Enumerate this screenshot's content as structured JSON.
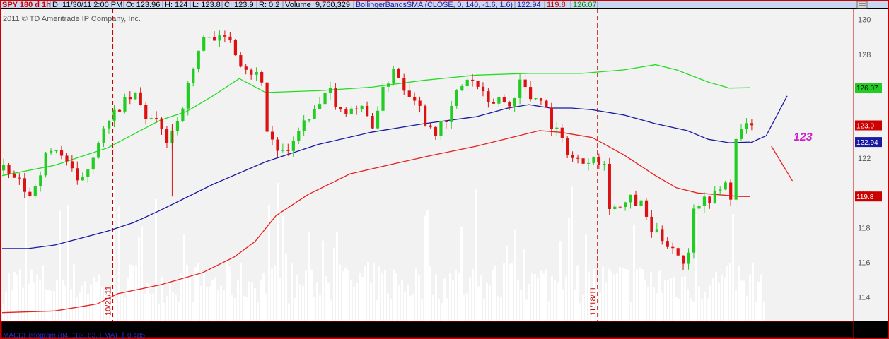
{
  "header": {
    "symbol": "SPY 180 d 1h",
    "date": "D: 11/30/11 2:00 PM",
    "open": "O: 123.96",
    "high": "H: 124",
    "low": "L: 123.8",
    "close": "C: 123.9",
    "range": "R: 0.2",
    "volume_label": "Volume",
    "volume_value": "9,760,329",
    "study_label": "BollingerBandsSMA (CLOSE, 0, 140, -1.6, 1.6)",
    "study_mid": "122.94",
    "study_low": "119.8",
    "study_up": "126.07"
  },
  "copyright": "2011 © TD Ameritrade IP Company, Inc.",
  "annotation": "123",
  "lower_panel": {
    "label": "MACDHistogram (84, 182, 63, EMA)",
    "value": "0.485"
  },
  "colors": {
    "up": "#22cc22",
    "down": "#dd1111",
    "upper_band": "#22dd22",
    "middle_band": "#1a1aa0",
    "lower_band": "#e82020",
    "annotation": "#cc22cc",
    "frame": "#cc0000",
    "plot_bg": "#f2f2f2"
  },
  "chart_data": {
    "type": "candlestick",
    "ylim": [
      112.6,
      130.6
    ],
    "y_ticks": [
      114,
      116,
      118,
      120,
      122,
      124,
      126,
      128,
      130
    ],
    "price_badges": [
      {
        "value": 126.07,
        "text": "126.07",
        "color": "#22cc22",
        "text_color": "#000"
      },
      {
        "value": 123.9,
        "text": "123.9",
        "color": "#cc0000",
        "text_color": "#fff"
      },
      {
        "value": 122.94,
        "text": "122.94",
        "color": "#1a1aa0",
        "text_color": "#fff"
      },
      {
        "value": 119.8,
        "text": "119.8",
        "color": "#cc0000",
        "text_color": "#fff"
      }
    ],
    "date_markers": [
      {
        "label": "10/21/11",
        "bar": 21
      },
      {
        "label": "11/18/11",
        "bar": 113
      }
    ],
    "close_path": [
      [
        0,
        121.3
      ],
      [
        3,
        120.6
      ],
      [
        5,
        119.8
      ],
      [
        8,
        122.1
      ],
      [
        10,
        122.6
      ],
      [
        12,
        121.8
      ],
      [
        14,
        120.5
      ],
      [
        16,
        121.5
      ],
      [
        18,
        123.1
      ],
      [
        20,
        124.0
      ],
      [
        22,
        125.0
      ],
      [
        25,
        125.6
      ],
      [
        27,
        124.4
      ],
      [
        29,
        124.0
      ],
      [
        31,
        123.1
      ],
      [
        33,
        124.2
      ],
      [
        35,
        126.1
      ],
      [
        37,
        128.2
      ],
      [
        39,
        129.3
      ],
      [
        41,
        128.8
      ],
      [
        43,
        129.0
      ],
      [
        45,
        127.6
      ],
      [
        47,
        127.0
      ],
      [
        49,
        126.6
      ],
      [
        50,
        123.6
      ],
      [
        52,
        122.5
      ],
      [
        54,
        122.1
      ],
      [
        56,
        123.8
      ],
      [
        58,
        124.2
      ],
      [
        60,
        125.1
      ],
      [
        62,
        125.8
      ],
      [
        64,
        124.7
      ],
      [
        66,
        125.0
      ],
      [
        68,
        124.8
      ],
      [
        70,
        124.0
      ],
      [
        72,
        125.8
      ],
      [
        74,
        127.3
      ],
      [
        76,
        126.1
      ],
      [
        78,
        125.6
      ],
      [
        80,
        124.2
      ],
      [
        82,
        123.6
      ],
      [
        84,
        124.0
      ],
      [
        86,
        125.8
      ],
      [
        88,
        126.6
      ],
      [
        90,
        126.1
      ],
      [
        92,
        125.0
      ],
      [
        94,
        125.5
      ],
      [
        96,
        125.0
      ],
      [
        98,
        126.5
      ],
      [
        100,
        125.5
      ],
      [
        102,
        125.6
      ],
      [
        104,
        124.0
      ],
      [
        106,
        123.0
      ],
      [
        108,
        122.0
      ],
      [
        110,
        121.8
      ],
      [
        112,
        122.3
      ],
      [
        114,
        121.6
      ],
      [
        115,
        119.4
      ],
      [
        117,
        119.1
      ],
      [
        119,
        119.6
      ],
      [
        121,
        119.3
      ],
      [
        123,
        117.8
      ],
      [
        125,
        117.4
      ],
      [
        127,
        116.9
      ],
      [
        129,
        116.1
      ],
      [
        130,
        116.4
      ],
      [
        131,
        119.4
      ],
      [
        133,
        119.6
      ],
      [
        135,
        119.9
      ],
      [
        137,
        120.5
      ],
      [
        138,
        119.9
      ],
      [
        139,
        123.0
      ],
      [
        141,
        123.9
      ],
      [
        142,
        123.9
      ]
    ],
    "upper_band_path": [
      [
        0,
        121.0
      ],
      [
        10,
        121.6
      ],
      [
        20,
        122.6
      ],
      [
        30,
        124.2
      ],
      [
        35,
        124.7
      ],
      [
        40,
        125.6
      ],
      [
        45,
        126.6
      ],
      [
        50,
        125.8
      ],
      [
        60,
        125.9
      ],
      [
        70,
        126.1
      ],
      [
        80,
        126.5
      ],
      [
        90,
        126.8
      ],
      [
        100,
        126.9
      ],
      [
        110,
        126.9
      ],
      [
        118,
        127.1
      ],
      [
        124,
        127.4
      ],
      [
        128,
        127.1
      ],
      [
        134,
        126.4
      ],
      [
        138,
        126.05
      ],
      [
        142,
        126.07
      ]
    ],
    "middle_band_path": [
      [
        0,
        116.8
      ],
      [
        5,
        116.8
      ],
      [
        10,
        117.0
      ],
      [
        20,
        117.8
      ],
      [
        25,
        118.3
      ],
      [
        30,
        119.0
      ],
      [
        40,
        120.5
      ],
      [
        50,
        121.8
      ],
      [
        60,
        122.8
      ],
      [
        70,
        123.5
      ],
      [
        80,
        124.0
      ],
      [
        90,
        124.4
      ],
      [
        96,
        124.9
      ],
      [
        100,
        125.1
      ],
      [
        104,
        124.9
      ],
      [
        108,
        124.9
      ],
      [
        112,
        124.8
      ],
      [
        118,
        124.5
      ],
      [
        124,
        124.0
      ],
      [
        130,
        123.6
      ],
      [
        134,
        123.1
      ],
      [
        138,
        122.9
      ],
      [
        142,
        122.94
      ]
    ],
    "lower_band_path": [
      [
        0,
        113.1
      ],
      [
        10,
        113.2
      ],
      [
        18,
        113.6
      ],
      [
        22,
        114.2
      ],
      [
        30,
        114.7
      ],
      [
        38,
        115.4
      ],
      [
        44,
        116.3
      ],
      [
        48,
        117.2
      ],
      [
        52,
        118.7
      ],
      [
        58,
        119.9
      ],
      [
        66,
        121.1
      ],
      [
        76,
        121.8
      ],
      [
        82,
        122.2
      ],
      [
        90,
        122.7
      ],
      [
        98,
        123.3
      ],
      [
        102,
        123.6
      ],
      [
        106,
        123.5
      ],
      [
        108,
        123.4
      ],
      [
        112,
        123.2
      ],
      [
        118,
        122.2
      ],
      [
        124,
        121.0
      ],
      [
        128,
        120.3
      ],
      [
        132,
        120.0
      ],
      [
        136,
        119.9
      ],
      [
        140,
        119.8
      ],
      [
        142,
        119.8
      ]
    ],
    "projection": [
      {
        "from": [
          142,
          122.9
        ],
        "mid": [
          145,
          123.3
        ],
        "to": [
          149,
          125.6
        ],
        "color": "#1a1aa0"
      },
      {
        "from": [
          146,
          122.7
        ],
        "to": [
          150,
          120.7
        ],
        "color": "#e82020"
      }
    ]
  }
}
